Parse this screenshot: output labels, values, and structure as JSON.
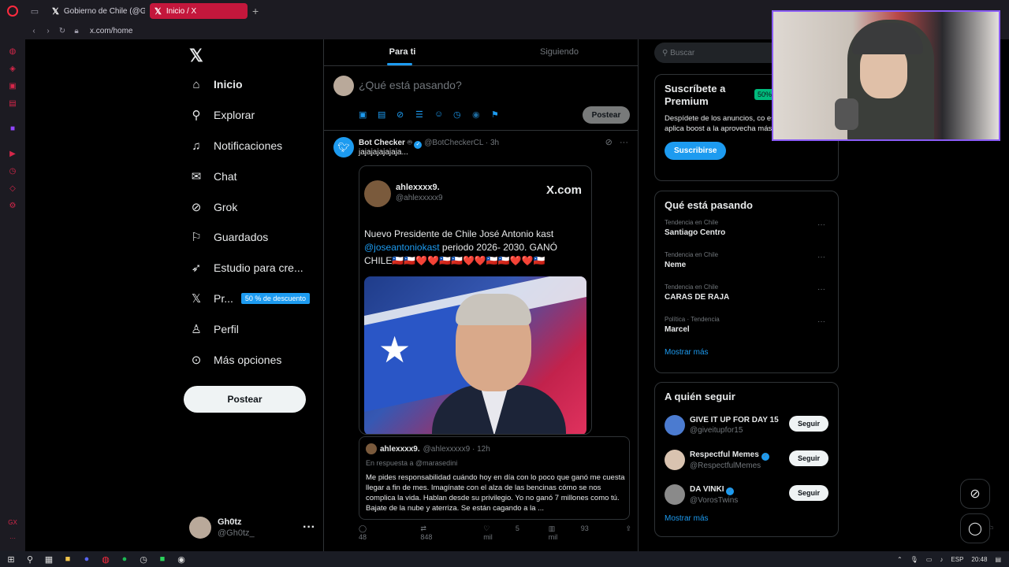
{
  "browser": {
    "tabs": [
      {
        "label": "Gobierno de Chile (@Gobi",
        "active": false
      },
      {
        "label": "Inicio / X",
        "active": true
      }
    ],
    "new_tab": "+",
    "url": "x.com/home"
  },
  "nav": {
    "items": [
      {
        "label": "Inicio",
        "icon": "home-icon",
        "active": true
      },
      {
        "label": "Explorar",
        "icon": "search-icon"
      },
      {
        "label": "Notificaciones",
        "icon": "bell-icon"
      },
      {
        "label": "Chat",
        "icon": "mail-icon"
      },
      {
        "label": "Grok",
        "icon": "grok-icon"
      },
      {
        "label": "Guardados",
        "icon": "bookmark-icon"
      },
      {
        "label": "Estudio para cre...",
        "icon": "rocket-icon"
      },
      {
        "label": "Pr...",
        "icon": "x-logo-icon"
      },
      {
        "label": "Perfil",
        "icon": "person-icon"
      },
      {
        "label": "Más opciones",
        "icon": "more-circle-icon"
      }
    ],
    "premium_badge": "50 % de descuento",
    "post_button": "Postear"
  },
  "profile": {
    "name": "Gh0tz",
    "handle": "@Gh0tz_"
  },
  "feed": {
    "tabs": [
      "Para ti",
      "Siguiendo"
    ],
    "composer_placeholder": "¿Qué está pasando?",
    "composer_post": "Postear"
  },
  "tweet": {
    "name": "Bot Checker",
    "handle": "@BotCheckerCL",
    "time": "· 3h",
    "text": "jajajajajajaja...",
    "embedded": {
      "name": "ahlexxxx9.",
      "handle": "@ahlexxxxx9",
      "brand": "X.com",
      "text_before": "Nuevo Presidente de Chile José Antonio kast ",
      "mention": "@joseantoniokast",
      "text_after": " periodo 2026- 2030. GANÓ CHILE🇨🇱🇨🇱❤️❤️🇨🇱🇨🇱❤️❤️🇨🇱🇨🇱❤️❤️🇨🇱"
    },
    "reply": {
      "name": "ahlexxxx9.",
      "handle": "@ahlexxxxx9",
      "time": "· 12h",
      "in_reply_to": "En respuesta a @marasedini",
      "text": "Me pides responsabilidad cuándo hoy en día con lo poco que ganó me cuesta llegar a fin de mes. Imagínate con el alza de las bencinas cómo se nos complica la vida. Hablan desde su privilegio. Yo no ganó 7 millones como tú. Bajate de la nube y aterriza. Se están cagando a la ..."
    },
    "stats": {
      "replies": "48",
      "reposts": "848",
      "likes": "5 mil",
      "views": "93 mil"
    }
  },
  "sidebar": {
    "search_placeholder": "Buscar",
    "premium": {
      "title": "Suscríbete a Premium",
      "badge": "50%",
      "text": "Despídete de los anuncios, co estadísticas, aplica boost a la aprovecha más de 20 caracte...",
      "button": "Suscribirse"
    },
    "trends": {
      "title": "Qué está pasando",
      "items": [
        {
          "category": "Tendencia en Chile",
          "name": "Santiago Centro"
        },
        {
          "category": "Tendencia en Chile",
          "name": "Neme"
        },
        {
          "category": "Tendencia en Chile",
          "name": "CARAS DE RAJA"
        },
        {
          "category": "Política · Tendencia",
          "name": "Marcel"
        }
      ],
      "show_more": "Mostrar más"
    },
    "follow": {
      "title": "A quién seguir",
      "items": [
        {
          "name": "GIVE IT UP FOR DAY 15",
          "handle": "@giveitupfor15",
          "verified": false,
          "color": "#4b7bd0"
        },
        {
          "name": "Respectful Memes",
          "handle": "@RespectfulMemes",
          "verified": true,
          "color": "#d9c3b0"
        },
        {
          "name": "DA VINKI",
          "handle": "@VorosTwins",
          "verified": true,
          "color": "#8a8a8a"
        }
      ],
      "button": "Seguir",
      "show_more": "Mostrar más"
    }
  },
  "taskbar": {
    "language": "ESP",
    "time": "20:48"
  },
  "colors": {
    "accent": "#1d9bf0",
    "opera_red": "#ff2b3f",
    "webcam_border": "#8a5cf6"
  }
}
